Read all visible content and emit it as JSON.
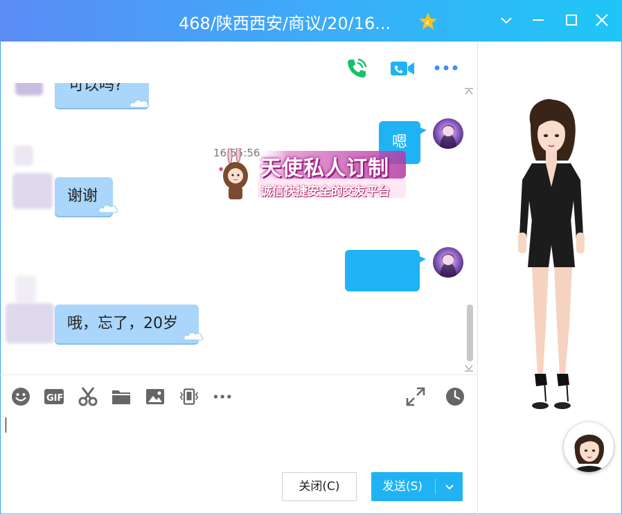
{
  "window": {
    "title": "468/陕西西安/商议/20/16..."
  },
  "messages": [
    {
      "side": "in",
      "text": "可以吗?"
    },
    {
      "side": "out",
      "text": "嗯"
    },
    {
      "side": "in",
      "text": "谢谢"
    },
    {
      "side": "out",
      "text": ""
    },
    {
      "side": "in",
      "text": "哦，忘了，20岁"
    }
  ],
  "timestamp": "16:55:56",
  "banner": {
    "main": "天使私人订制",
    "sub": "诚信快捷安全的交友平台"
  },
  "toolbar": {
    "icons": [
      "emoji-icon",
      "gif-icon",
      "scissors-icon",
      "folder-icon",
      "image-icon",
      "shake-icon",
      "more-icon",
      "expand-icon",
      "history-icon"
    ]
  },
  "input": {
    "value": ""
  },
  "buttons": {
    "close_label": "关闭(C)",
    "send_label": "发送(S)"
  },
  "header_icons": [
    "phone-icon",
    "video-icon",
    "more-icon"
  ],
  "colors": {
    "accent": "#21b2f4",
    "bubble_in": "#a9d6fa",
    "bubble_out": "#1fb3f4",
    "phone": "#17c26a"
  }
}
